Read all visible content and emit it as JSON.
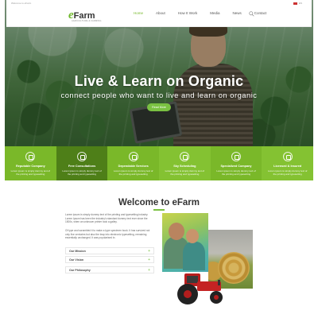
{
  "nav": {
    "top_left": "Welcome to eFarm",
    "lang": "EN",
    "logo_e": "e",
    "logo_farm": "Farm",
    "logo_sub": "AGRICULTURE & FARMING",
    "menu": [
      "Home",
      "About",
      "How It Work",
      "Media",
      "News",
      "Contact"
    ]
  },
  "hero": {
    "title": "Live & Learn on Organic",
    "subtitle": "connect people who want to live and learn on organic",
    "button": "Read More"
  },
  "features": [
    {
      "title": "Reputable Company",
      "text": "Lorem ipsum is simply dummy text of the printing and typesetting"
    },
    {
      "title": "Free Consultations",
      "text": "Lorem ipsum is simply dummy text of the printing and typesetting"
    },
    {
      "title": "Dependable Services",
      "text": "Lorem ipsum is simply dummy text of the printing and typesetting"
    },
    {
      "title": "Sky Scheduling",
      "text": "Lorem ipsum is simply dummy text of the printing and typesetting"
    },
    {
      "title": "Specialized Company",
      "text": "Lorem ipsum is simply dummy text of the printing and typesetting"
    },
    {
      "title": "Licensed & Insured",
      "text": "Lorem ipsum is simply dummy text of the printing and typesetting"
    }
  ],
  "welcome": {
    "title": "Welcome to eFarm",
    "para1": "Lorem ipsum is simply dummy text of the printing and typesetting industry. Lorem Ipsum has been the industry's standard dummy text ever since the 1500s, when an unknown printer took a galley.",
    "para2": "Of type and scrambled it to make a type specimen book. It has survived not only five centuries but also the leap into electronic typesetting, remaining essentially unchanged. It was popularised in.",
    "accordion": [
      "Our Mission",
      "Our Vision",
      "Our Philosophy"
    ]
  },
  "colors": {
    "accent": "#7ac142",
    "dark_green": "#4e7f18"
  }
}
